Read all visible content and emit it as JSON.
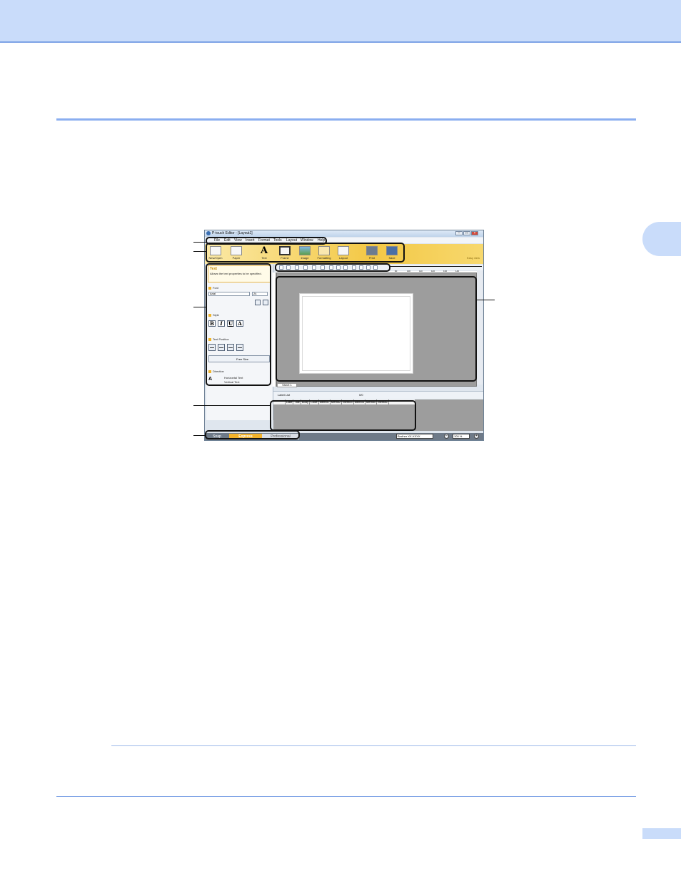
{
  "window": {
    "title": "P-touch Editor - [Layout1]",
    "controls": [
      "–",
      "□",
      "×"
    ]
  },
  "menu": [
    "File",
    "Edit",
    "View",
    "Insert",
    "Format",
    "Tools",
    "Layout",
    "Window",
    "Help"
  ],
  "ribbon": {
    "buttons": [
      "New/Open",
      "Paper",
      "Text",
      "Frame",
      "Image",
      "Formatting",
      "Layout",
      "Print",
      "Save"
    ],
    "brand": "Easy view"
  },
  "properties": {
    "heading": "Text",
    "description": "Allows the text properties to be specified.",
    "font_label": "Font",
    "font_value": "Arial",
    "size_value": "24",
    "style_label": "Style",
    "style_buttons": [
      "B",
      "I",
      "U",
      "A"
    ],
    "text_position_label": "Text Position",
    "free_size": "Free Size",
    "direction_label": "Direction",
    "horizontal": "Horizontal Text",
    "vertical": "Vertical Text"
  },
  "ruler_labels": [
    "10",
    "20",
    "30",
    "40",
    "50",
    "60",
    "70",
    "80",
    "90",
    "100",
    "110",
    "120",
    "130",
    "140"
  ],
  "sheet_tab": "Sheet 1",
  "database": {
    "label": "Label List",
    "record": "0/0",
    "columns": [
      "Date",
      "Title",
      "Body",
      "Code",
      "Memo1",
      "Memo2",
      "Memo3",
      "Memo4",
      "Memo5",
      "Memo6"
    ]
  },
  "status": {
    "modes": [
      "Snap",
      "Express",
      "Professional"
    ],
    "printer": "Brother XX-XXXX",
    "zoom": "100 %"
  }
}
